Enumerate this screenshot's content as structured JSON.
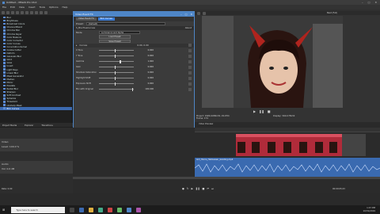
{
  "window": {
    "title": "Untitled - VEGAS Pro 16.0"
  },
  "menu": [
    "File",
    "Edit",
    "View",
    "Insert",
    "Tools",
    "Options",
    "Help"
  ],
  "media_tree": {
    "items": [
      "Blur",
      "Brightness",
      "Broadcast Colors",
      "Channel Blend",
      "Chroma Blur",
      "Chroma Keyer",
      "Color Balance",
      "Color Corrector",
      "Color Curves",
      "Convolution Kernel",
      "Cookie Cutter",
      "Deform",
      "Gaussian Blur",
      "Glint",
      "Glow",
      "Invert",
      "Light Rays",
      "Linear Blur",
      "Mask Generator",
      "Median",
      "Mirror",
      "Pixelate",
      "Radial Blur",
      "Sharpen",
      "Soft Contrast",
      "Spherize",
      "Threshold",
      "Unsharp Mask",
      "BCC Curves"
    ],
    "selected_index": 28,
    "tabs": [
      "Project Media",
      "Explorer",
      "Transitions"
    ]
  },
  "fx_window": {
    "title": "Video Event FX",
    "tabs": [
      "Video Event FX",
      "BCC Curves"
    ],
    "preset_label": "Preset:",
    "preset_value": "(Default)",
    "plugin_name": "S_BlurHueCurves",
    "about": "About",
    "mode_label": "Mode",
    "mode_value": "Luminance and Alpha",
    "load_preset": "Load Preset",
    "save_preset": "Save Preset",
    "section": "Curves",
    "section_value": "0.00, 0.00",
    "params": [
      {
        "label": "X Tone",
        "value": "0.000",
        "pos": 0.45
      },
      {
        "label": "Y Tone",
        "value": "0.000",
        "pos": 0.45
      },
      {
        "label": "Gamma",
        "value": "1.000",
        "pos": 0.6
      },
      {
        "label": "Gain",
        "value": "0.000",
        "pos": 0.45
      },
      {
        "label": "Shadows Saturation",
        "value": "0.000",
        "pos": 0.45
      },
      {
        "label": "Highlight Shift",
        "value": "0.000",
        "pos": 0.45
      },
      {
        "label": "Exposure Shift",
        "value": "0.000",
        "pos": 0.45
      },
      {
        "label": "Mix with Original",
        "value": "100.000",
        "pos": 0.95
      }
    ],
    "key_label": "Keyframes",
    "time": "00:00:00;00"
  },
  "preview": {
    "quality": "Best (Full)",
    "project": "Project: 1920x1080x32, 29.970i",
    "frame": "Frame: 174",
    "display": "Display: 316x178x32",
    "tab": "Video Preview"
  },
  "timeline": {
    "tracks": [
      {
        "name": "Video",
        "level": "Level: 100.0 %"
      },
      {
        "name": "Audio",
        "level": "Vol: 0.0 dB"
      }
    ],
    "clip_name": "Girl_Horns_Halloween_Grading.mp4",
    "time": "00:00:05;23",
    "rate": "Rate: 0.00"
  },
  "taskbar": {
    "search": "Type here to search",
    "time": "1:47 PM",
    "date": "10/31/2019"
  },
  "colors": {
    "accent": "#3a7bd5",
    "horns": "#b0241e",
    "clip_video": "#b02b3a",
    "clip_audio": "#3a6ab0"
  }
}
